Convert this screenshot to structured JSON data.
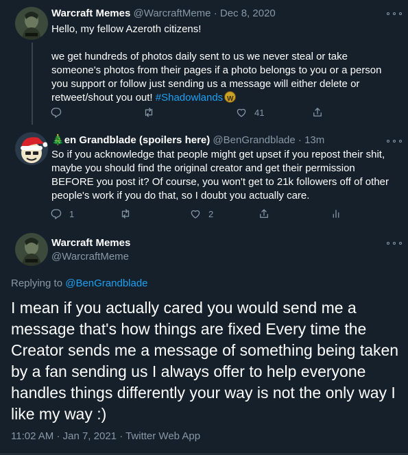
{
  "tweet1": {
    "name": "Warcraft Memes",
    "handle": "@WarcraftMeme",
    "separator": "·",
    "date": "Dec 8, 2020",
    "line1": "Hello, my fellow Azeroth citizens!",
    "paragraph": "we get hundreds of photos daily sent to us we never steal or take someone's photos from their pages if a photo belongs to you or a person you support or follow just sending us a message will either delete or retweet/shout you out!",
    "hashtag": "#Shadowlands",
    "likes": "41"
  },
  "tweet2": {
    "emoji": "🎄",
    "name": "en Grandblade (spoilers here)",
    "handle": "@BenGrandblade",
    "separator": "·",
    "time": "13m",
    "text": "So if you acknowledge that people might get upset if you repost their shit, maybe you should find the original creator and get their permission BEFORE you post it? Of course, you won't get to 21k followers off of other people's work if you do that, so I doubt you actually care.",
    "replies": "1",
    "likes": "2"
  },
  "tweet3": {
    "name": "Warcraft Memes",
    "handle": "@WarcraftMeme",
    "replying_label": "Replying to",
    "replying_handle": "@BenGrandblade",
    "text": "I mean if you actually cared you would send me a message that's how things are fixed  Every time the Creator sends me a message of something being taken by a fan sending us I always offer to help everyone handles things differently your way is not the only way I like my way :)",
    "time": "11:02 AM",
    "separator": "·",
    "date": "Jan 7, 2021",
    "source_separator": "·",
    "source": "Twitter Web App"
  },
  "colors": {
    "background": "#15202b",
    "muted": "#8899a6",
    "link": "#1da1f2",
    "divider": "#38444d"
  },
  "icons": [
    "reply-icon",
    "retweet-icon",
    "like-icon",
    "share-icon",
    "analytics-icon",
    "more-icon"
  ]
}
